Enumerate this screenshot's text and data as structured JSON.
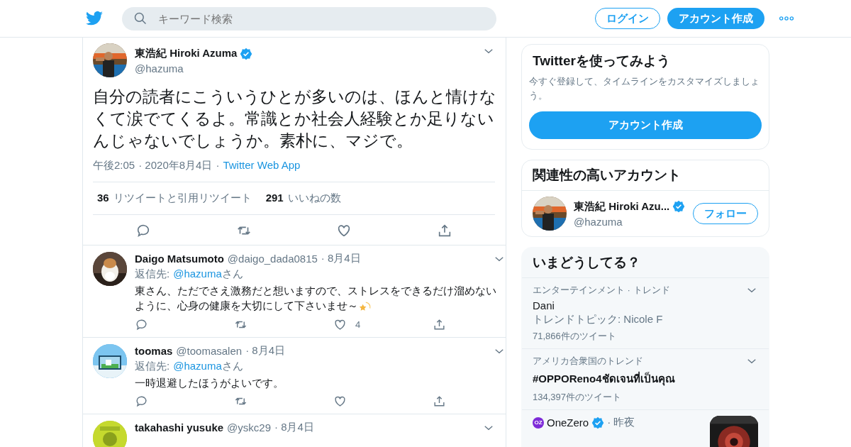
{
  "header": {
    "search": {
      "placeholder": "キーワード検索"
    },
    "login": "ログイン",
    "signup": "アカウント作成"
  },
  "main_tweet": {
    "name": "東浩紀 Hiroki Azuma",
    "verified": true,
    "handle": "@hazuma",
    "text": "自分の読者にこういうひとが多いのは、ほんと情けなくて涙でてくるよ。常識とか社会人経験とか足りないんじゃないでしょうか。素朴に、マジで。",
    "time": "午後2:05",
    "date": "· 2020年8月4日",
    "source_sep": "·",
    "source": "Twitter Web App",
    "stats": [
      {
        "count": "36",
        "label": "リツイートと引用リツイート"
      },
      {
        "count": "291",
        "label": "いいねの数"
      }
    ]
  },
  "replies": [
    {
      "name": "Daigo Matsumoto",
      "handle": "@daigo_dada0815",
      "date": "· 8月4日",
      "reply_label": "返信先:",
      "reply_to": "@hazuma",
      "reply_suffix": "さん",
      "text": "東さん、ただでさえ激務だと想いますので、ストレスをできるだけ溜めないように、心身の健康を大切にして下さいませ～",
      "sparkle": true,
      "likes": "4"
    },
    {
      "name": "toomas",
      "handle": "@toomasalen",
      "date": "· 8月4日",
      "reply_label": "返信先:",
      "reply_to": "@hazuma",
      "reply_suffix": "さん",
      "text": "一時退避したほうがよいです。",
      "sparkle": false
    },
    {
      "name": "takahashi yusuke",
      "handle": "@yskc29",
      "date": "· 8月4日"
    }
  ],
  "sidebar": {
    "signup_card": {
      "title": "Twitterを使ってみよう",
      "text": "今すぐ登録して、タイムラインをカスタマイズしましょう。",
      "button": "アカウント作成"
    },
    "related": {
      "title": "関連性の高いアカウント",
      "accounts": [
        {
          "name": "東浩紀 Hiroki Azu...",
          "verified": true,
          "handle": "@hazuma",
          "follow": "フォロー"
        }
      ]
    },
    "trends": {
      "title": "いまどうしてる？",
      "items": [
        {
          "kind": "trend",
          "context": "エンターテインメント · トレンド",
          "name": "Dani",
          "topic": "トレンドトピック: Nicole F",
          "count": "71,866件のツイート"
        },
        {
          "kind": "trend",
          "context": "アメリカ合衆国のトレンド",
          "name": "#OPPOReno4ชัดเจนที่เป็นคุณ",
          "count": "134,397件のツイート"
        },
        {
          "kind": "news",
          "logo": "OZ",
          "source": "OneZero",
          "verified": true,
          "time": "· 昨夜"
        }
      ]
    }
  }
}
